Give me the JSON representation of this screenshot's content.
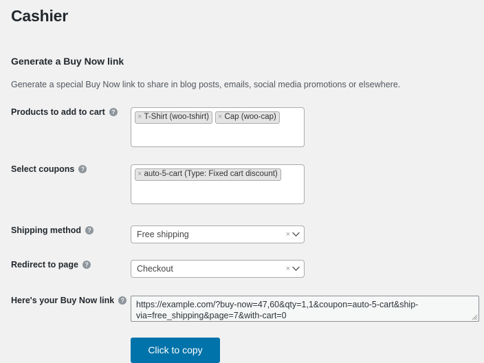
{
  "page": {
    "title": "Cashier",
    "section_title": "Generate a Buy Now link",
    "section_desc": "Generate a special Buy Now link to share in blog posts, emails, social media promotions or elsewhere."
  },
  "icons": {
    "help": "?",
    "remove": "×",
    "clear": "×"
  },
  "colors": {
    "background": "#f1f1f1",
    "button": "#0073aa",
    "heading": "#23282d",
    "field_border": "#aaaaaa",
    "token_bg": "#e4e4e4"
  },
  "fields": {
    "products": {
      "label": "Products to add to cart",
      "tokens": [
        {
          "label": "T-Shirt (woo-tshirt)"
        },
        {
          "label": "Cap (woo-cap)"
        }
      ]
    },
    "coupons": {
      "label": "Select coupons",
      "tokens": [
        {
          "label": "auto-5-cart (Type: Fixed cart discount)"
        }
      ]
    },
    "shipping": {
      "label": "Shipping method",
      "value": "Free shipping"
    },
    "redirect": {
      "label": "Redirect to page",
      "value": "Checkout"
    },
    "buy_now_link": {
      "label": "Here's your Buy Now link",
      "value": "https://example.com/?buy-now=47,60&qty=1,1&coupon=auto-5-cart&ship-via=free_shipping&page=7&with-cart=0"
    }
  },
  "actions": {
    "copy_label": "Click to copy"
  }
}
